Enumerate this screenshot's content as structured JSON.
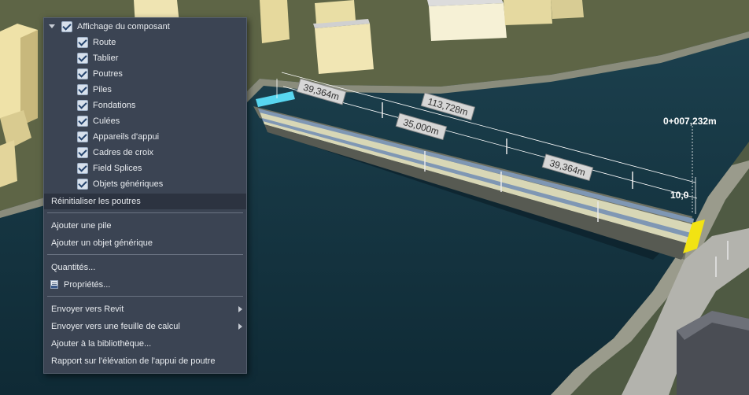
{
  "colors": {
    "menu_bg": "#3b4453",
    "menu_highlight": "#2c3340",
    "menu_text": "#e8ebef",
    "water": "#13303c",
    "deck": "#d8d7b6",
    "lane_blue": "#7f97b4",
    "selection_yellow": "#f2e313",
    "selection_cyan": "#58d6f0"
  },
  "viewport": {
    "dimensions": {
      "total": "113,728m",
      "span_left": "39,364m",
      "span_mid": "35,000m",
      "span_right": "39,364m",
      "offset": "10,0"
    },
    "station_label": "0+007,232m"
  },
  "menu": {
    "header": {
      "label": "Affichage du composant",
      "checked": true,
      "expanded": true
    },
    "components": [
      {
        "label": "Route",
        "checked": true
      },
      {
        "label": "Tablier",
        "checked": true
      },
      {
        "label": "Poutres",
        "checked": true
      },
      {
        "label": "Piles",
        "checked": true
      },
      {
        "label": "Fondations",
        "checked": true
      },
      {
        "label": "Culées",
        "checked": true
      },
      {
        "label": "Appareils d'appui",
        "checked": true
      },
      {
        "label": "Cadres de croix",
        "checked": true
      },
      {
        "label": "Field Splices",
        "checked": true
      },
      {
        "label": "Objets génériques",
        "checked": true
      }
    ],
    "reset_girders": "Réinitialiser les poutres",
    "add_pier": "Ajouter une pile",
    "add_generic": "Ajouter un objet générique",
    "quantities": "Quantités...",
    "properties": "Propriétés...",
    "send_revit": "Envoyer vers Revit",
    "send_spreadsheet": "Envoyer vers une feuille de calcul",
    "add_library": "Ajouter à la bibliothèque...",
    "report_elevation": "Rapport sur l'élévation de l'appui de poutre"
  }
}
